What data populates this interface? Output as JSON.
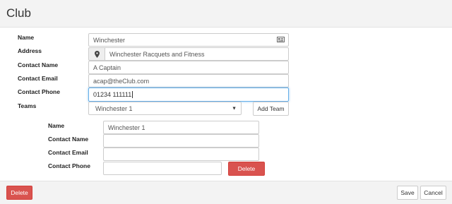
{
  "header": {
    "title": "Club"
  },
  "club": {
    "name_label": "Name",
    "name_value": "Winchester",
    "address_label": "Address",
    "address_value": "Winchester Racquets and Fitness",
    "contact_name_label": "Contact Name",
    "contact_name_value": "A Captain",
    "contact_email_label": "Contact Email",
    "contact_email_value": "acap@theClub.com",
    "contact_phone_label": "Contact Phone",
    "contact_phone_value": "01234 111111",
    "teams_label": "Teams",
    "teams_selected": "Winchester 1",
    "add_team_label": "Add Team"
  },
  "team": {
    "name_label": "Name",
    "name_value": "Winchester 1",
    "contact_name_label": "Contact Name",
    "contact_name_value": "",
    "contact_email_label": "Contact Email",
    "contact_email_value": "",
    "contact_phone_label": "Contact Phone",
    "contact_phone_value": "",
    "delete_label": "Delete"
  },
  "footer": {
    "delete_label": "Delete",
    "save_label": "Save",
    "cancel_label": "Cancel"
  },
  "icons": {
    "card": "id-card-icon",
    "marker": "map-marker-icon",
    "dropdown": "caret-down-icon"
  },
  "colors": {
    "danger": "#d9534f",
    "focus": "#66afe9"
  }
}
